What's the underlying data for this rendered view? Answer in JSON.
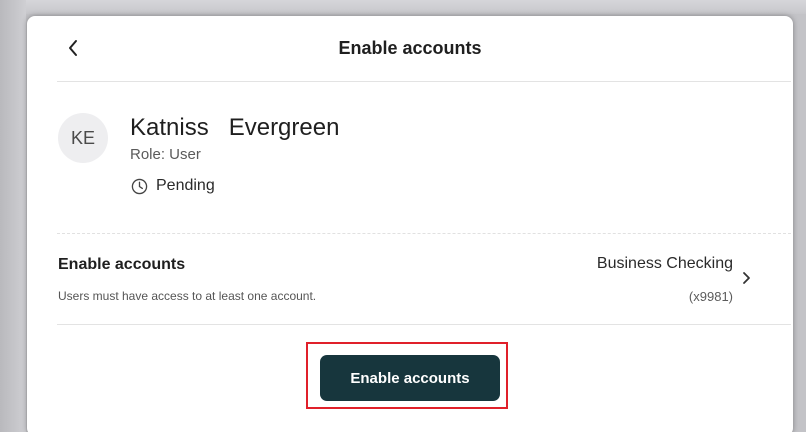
{
  "header": {
    "back_icon": "chevron-left-icon",
    "title": "Enable accounts"
  },
  "user": {
    "initials": "KE",
    "name": "Katniss   Evergreen",
    "role": "Role: User",
    "status_icon": "clock-icon",
    "status": "Pending"
  },
  "accounts_row": {
    "title": "Enable accounts",
    "subtitle": "Users must have access to at least one account.",
    "account_name": "Business Checking",
    "account_number": "(x9981)",
    "chevron_icon": "chevron-right-icon"
  },
  "actions": {
    "enable_label": "Enable accounts",
    "highlight_color": "#e0202a",
    "button_color": "#17363d"
  }
}
